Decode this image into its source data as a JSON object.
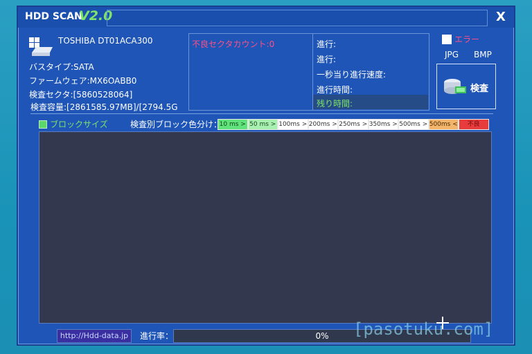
{
  "window": {
    "title": "HDD SCAN",
    "version": "V2.0",
    "close_glyph": "X"
  },
  "drive": {
    "model": "TOSHIBA DT01ACA300",
    "bus_type": "バスタイプ:SATA",
    "firmware": "ファームウェア:MX6OABB0",
    "sectors": "検査セクタ:[5860528064]",
    "capacity": "検査容量:[2861585.97MB]/[2794.5G"
  },
  "stats": {
    "bad_sectors": "不良セクタカウント:0",
    "progress": "進行:",
    "progress2": "進行:",
    "speed": "一秒当り進行速度:",
    "elapsed": "進行時間:",
    "remaining": "残り時間:"
  },
  "options": {
    "error_label": "エラー",
    "jpg": "JPG",
    "bmp": "BMP",
    "scan_button": "検査"
  },
  "legend": {
    "block_size_label": "ブロックサイズ",
    "title": "検査別ブロック色分け：",
    "items": [
      {
        "label": "10 ms >",
        "bg": "#5fe37a",
        "fg": "#10451b"
      },
      {
        "label": "50 ms >",
        "bg": "#a8f0b0",
        "fg": "#1d4a22"
      },
      {
        "label": "100ms >",
        "bg": "#ffffff",
        "fg": "#333333"
      },
      {
        "label": "200ms >",
        "bg": "#ffffff",
        "fg": "#333333"
      },
      {
        "label": "250ms >",
        "bg": "#ffffff",
        "fg": "#333333"
      },
      {
        "label": "350ms >",
        "bg": "#ffffff",
        "fg": "#333333"
      },
      {
        "label": "500ms >",
        "bg": "#ffffff",
        "fg": "#333333"
      },
      {
        "label": "500ms <",
        "bg": "#f2b56b",
        "fg": "#4a2a06"
      },
      {
        "label": "不良",
        "bg": "#e83b3b",
        "fg": "#6a0b0b"
      }
    ]
  },
  "footer": {
    "url": "http://Hdd-data.jp",
    "progress_label": "進行率：",
    "progress_text": "0%",
    "progress_value": 0
  },
  "watermark": "[pasotuku.com]"
}
